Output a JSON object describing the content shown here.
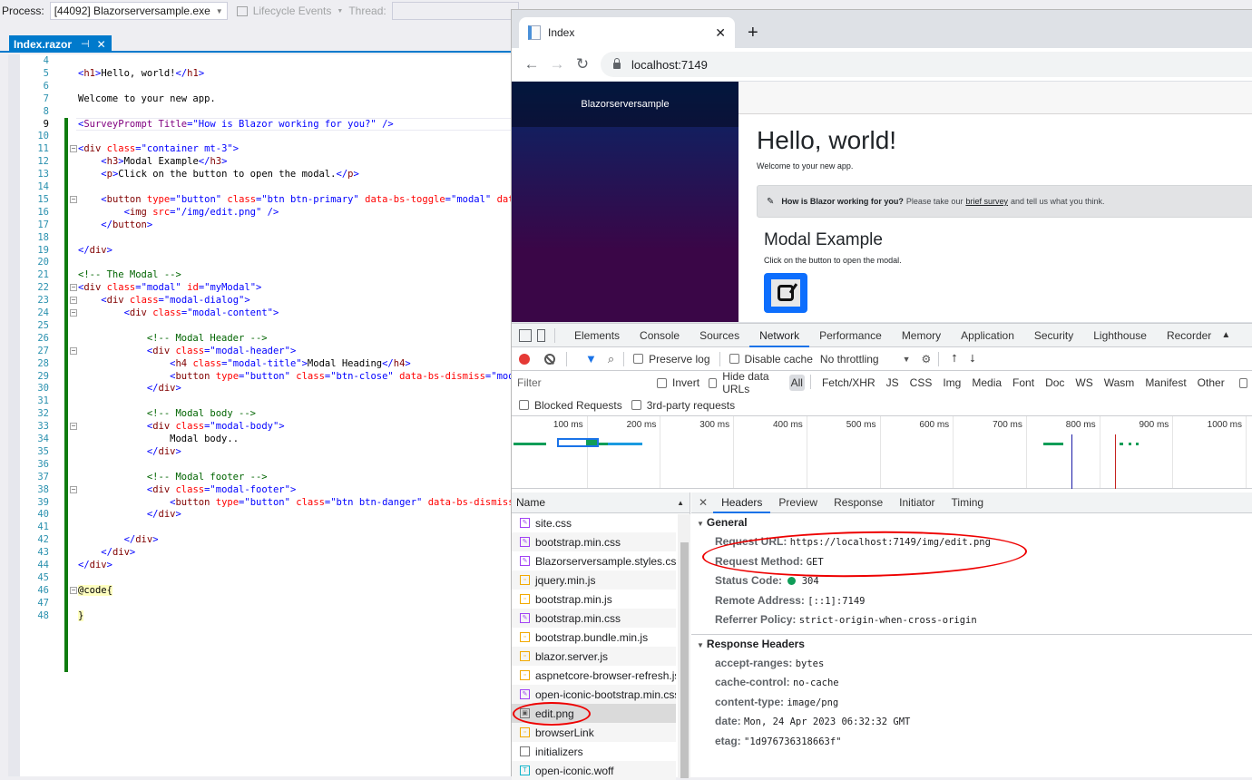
{
  "vs": {
    "process_label": "Process:",
    "process_value": "[44092] Blazorserversample.exe",
    "lifecycle_label": "Lifecycle Events",
    "thread_label": "Thread:",
    "doc_tab": "Index.razor"
  },
  "editor": {
    "lines": [
      {
        "n": "4",
        "html": ""
      },
      {
        "n": "5",
        "html": "<span class='t-tag'>&lt;</span><span class='t-name'>h1</span><span class='t-tag'>&gt;</span><span class='t-txt'>Hello, world!</span><span class='t-tag'>&lt;/</span><span class='t-name'>h1</span><span class='t-tag'>&gt;</span>"
      },
      {
        "n": "6",
        "html": ""
      },
      {
        "n": "7",
        "html": "<span class='t-txt'>Welcome to your new app.</span>"
      },
      {
        "n": "8",
        "html": ""
      },
      {
        "n": "9",
        "html": "<span class='t-tag'>&lt;</span><span class='t-comp'>SurveyPrompt</span> <span class='t-comp'>Title</span><span class='t-tag'>=</span><span class='t-val'>\"How is Blazor working for you?\"</span> <span class='t-tag'>/&gt;</span>"
      },
      {
        "n": "10",
        "html": ""
      },
      {
        "n": "11",
        "html": "<span class='t-tag'>&lt;</span><span class='t-name'>div</span> <span class='t-attr'>class</span><span class='t-tag'>=</span><span class='t-val'>\"container mt-3\"</span><span class='t-tag'>&gt;</span>"
      },
      {
        "n": "12",
        "html": "    <span class='t-tag'>&lt;</span><span class='t-name'>h3</span><span class='t-tag'>&gt;</span><span class='t-txt'>Modal Example</span><span class='t-tag'>&lt;/</span><span class='t-name'>h3</span><span class='t-tag'>&gt;</span>"
      },
      {
        "n": "13",
        "html": "    <span class='t-tag'>&lt;</span><span class='t-name'>p</span><span class='t-tag'>&gt;</span><span class='t-txt'>Click on the button to open the modal.</span><span class='t-tag'>&lt;/</span><span class='t-name'>p</span><span class='t-tag'>&gt;</span>"
      },
      {
        "n": "14",
        "html": ""
      },
      {
        "n": "15",
        "html": "    <span class='t-tag'>&lt;</span><span class='t-name'>button</span> <span class='t-attr'>type</span><span class='t-tag'>=</span><span class='t-val'>\"button\"</span> <span class='t-attr'>class</span><span class='t-tag'>=</span><span class='t-val'>\"btn btn-primary\"</span> <span class='t-attr'>data-bs-toggle</span><span class='t-tag'>=</span><span class='t-val'>\"modal\"</span> <span class='t-attr'>data-</span>"
      },
      {
        "n": "16",
        "html": "        <span class='t-tag'>&lt;</span><span class='t-name'>img</span> <span class='t-attr'>src</span><span class='t-tag'>=</span><span class='t-val'>\"/img/edit.png\"</span> <span class='t-tag'>/&gt;</span>"
      },
      {
        "n": "17",
        "html": "    <span class='t-tag'>&lt;/</span><span class='t-name'>button</span><span class='t-tag'>&gt;</span>"
      },
      {
        "n": "18",
        "html": ""
      },
      {
        "n": "19",
        "html": "<span class='t-tag'>&lt;/</span><span class='t-name'>div</span><span class='t-tag'>&gt;</span>"
      },
      {
        "n": "20",
        "html": ""
      },
      {
        "n": "21",
        "html": "<span class='t-cmt'>&lt;!-- The Modal --&gt;</span>"
      },
      {
        "n": "22",
        "html": "<span class='t-tag'>&lt;</span><span class='t-name'>div</span> <span class='t-attr'>class</span><span class='t-tag'>=</span><span class='t-val'>\"modal\"</span> <span class='t-attr'>id</span><span class='t-tag'>=</span><span class='t-val'>\"myModal\"</span><span class='t-tag'>&gt;</span>"
      },
      {
        "n": "23",
        "html": "    <span class='t-tag'>&lt;</span><span class='t-name'>div</span> <span class='t-attr'>class</span><span class='t-tag'>=</span><span class='t-val'>\"modal-dialog\"</span><span class='t-tag'>&gt;</span>"
      },
      {
        "n": "24",
        "html": "        <span class='t-tag'>&lt;</span><span class='t-name'>div</span> <span class='t-attr'>class</span><span class='t-tag'>=</span><span class='t-val'>\"modal-content\"</span><span class='t-tag'>&gt;</span>"
      },
      {
        "n": "25",
        "html": ""
      },
      {
        "n": "26",
        "html": "            <span class='t-cmt'>&lt;!-- Modal Header --&gt;</span>"
      },
      {
        "n": "27",
        "html": "            <span class='t-tag'>&lt;</span><span class='t-name'>div</span> <span class='t-attr'>class</span><span class='t-tag'>=</span><span class='t-val'>\"modal-header\"</span><span class='t-tag'>&gt;</span>"
      },
      {
        "n": "28",
        "html": "                <span class='t-tag'>&lt;</span><span class='t-name'>h4</span> <span class='t-attr'>class</span><span class='t-tag'>=</span><span class='t-val'>\"modal-title\"</span><span class='t-tag'>&gt;</span><span class='t-txt'>Modal Heading</span><span class='t-tag'>&lt;/</span><span class='t-name'>h4</span><span class='t-tag'>&gt;</span>"
      },
      {
        "n": "29",
        "html": "                <span class='t-tag'>&lt;</span><span class='t-name'>button</span> <span class='t-attr'>type</span><span class='t-tag'>=</span><span class='t-val'>\"button\"</span> <span class='t-attr'>class</span><span class='t-tag'>=</span><span class='t-val'>\"btn-close\"</span> <span class='t-attr'>data-bs-dismiss</span><span class='t-tag'>=</span><span class='t-val'>\"modal</span>"
      },
      {
        "n": "30",
        "html": "            <span class='t-tag'>&lt;/</span><span class='t-name'>div</span><span class='t-tag'>&gt;</span>"
      },
      {
        "n": "31",
        "html": ""
      },
      {
        "n": "32",
        "html": "            <span class='t-cmt'>&lt;!-- Modal body --&gt;</span>"
      },
      {
        "n": "33",
        "html": "            <span class='t-tag'>&lt;</span><span class='t-name'>div</span> <span class='t-attr'>class</span><span class='t-tag'>=</span><span class='t-val'>\"modal-body\"</span><span class='t-tag'>&gt;</span>"
      },
      {
        "n": "34",
        "html": "                <span class='t-txt'>Modal body..</span>"
      },
      {
        "n": "35",
        "html": "            <span class='t-tag'>&lt;/</span><span class='t-name'>div</span><span class='t-tag'>&gt;</span>"
      },
      {
        "n": "36",
        "html": ""
      },
      {
        "n": "37",
        "html": "            <span class='t-cmt'>&lt;!-- Modal footer --&gt;</span>"
      },
      {
        "n": "38",
        "html": "            <span class='t-tag'>&lt;</span><span class='t-name'>div</span> <span class='t-attr'>class</span><span class='t-tag'>=</span><span class='t-val'>\"modal-footer\"</span><span class='t-tag'>&gt;</span>"
      },
      {
        "n": "39",
        "html": "                <span class='t-tag'>&lt;</span><span class='t-name'>button</span> <span class='t-attr'>type</span><span class='t-tag'>=</span><span class='t-val'>\"button\"</span> <span class='t-attr'>class</span><span class='t-tag'>=</span><span class='t-val'>\"btn btn-danger\"</span> <span class='t-attr'>data-bs-dismiss</span><span class='t-tag'>=</span>"
      },
      {
        "n": "40",
        "html": "            <span class='t-tag'>&lt;/</span><span class='t-name'>div</span><span class='t-tag'>&gt;</span>"
      },
      {
        "n": "41",
        "html": ""
      },
      {
        "n": "42",
        "html": "        <span class='t-tag'>&lt;/</span><span class='t-name'>div</span><span class='t-tag'>&gt;</span>"
      },
      {
        "n": "43",
        "html": "    <span class='t-tag'>&lt;/</span><span class='t-name'>div</span><span class='t-tag'>&gt;</span>"
      },
      {
        "n": "44",
        "html": "<span class='t-tag'>&lt;/</span><span class='t-name'>div</span><span class='t-tag'>&gt;</span>"
      },
      {
        "n": "45",
        "html": ""
      },
      {
        "n": "46",
        "html": "<span class='t-razor'>@code{</span>"
      },
      {
        "n": "47",
        "html": ""
      },
      {
        "n": "48",
        "html": "<span class='t-razor'>}</span>"
      }
    ]
  },
  "browser": {
    "tab_title": "Index",
    "url": "localhost:7149",
    "page": {
      "brand": "Blazorserversample",
      "h1": "Hello, world!",
      "welcome": "Welcome to your new app.",
      "survey_bold": "How is Blazor working for you?",
      "survey_pre": "Please take our",
      "survey_link": "brief survey",
      "survey_post": "and tell us what you think.",
      "h3": "Modal Example",
      "p": "Click on the button to open the modal."
    }
  },
  "devtools": {
    "tabs": [
      "Elements",
      "Console",
      "Sources",
      "Network",
      "Performance",
      "Memory",
      "Application",
      "Security",
      "Lighthouse",
      "Recorder"
    ],
    "active_tab": "Network",
    "toolbar": {
      "preserve_log": "Preserve log",
      "disable_cache": "Disable cache",
      "throttling": "No throttling"
    },
    "filter": {
      "placeholder": "Filter",
      "invert": "Invert",
      "hide_data_urls": "Hide data URLs",
      "types": [
        "All",
        "Fetch/XHR",
        "JS",
        "CSS",
        "Img",
        "Media",
        "Font",
        "Doc",
        "WS",
        "Wasm",
        "Manifest",
        "Other"
      ],
      "active_type": "All",
      "blocked_requests": "Blocked Requests",
      "third_party": "3rd-party requests"
    },
    "overview": {
      "ticks": [
        "100 ms",
        "200 ms",
        "300 ms",
        "400 ms",
        "500 ms",
        "600 ms",
        "700 ms",
        "800 ms",
        "900 ms",
        "1000 ms"
      ]
    },
    "requests": {
      "column": "Name",
      "items": [
        {
          "name": "site.css",
          "type": "css"
        },
        {
          "name": "bootstrap.min.css",
          "type": "css"
        },
        {
          "name": "Blazorserversample.styles.css",
          "type": "css"
        },
        {
          "name": "jquery.min.js",
          "type": "js"
        },
        {
          "name": "bootstrap.min.js",
          "type": "js"
        },
        {
          "name": "bootstrap.min.css",
          "type": "css"
        },
        {
          "name": "bootstrap.bundle.min.js",
          "type": "js"
        },
        {
          "name": "blazor.server.js",
          "type": "js"
        },
        {
          "name": "aspnetcore-browser-refresh.js",
          "type": "js"
        },
        {
          "name": "open-iconic-bootstrap.min.css",
          "type": "css"
        },
        {
          "name": "edit.png",
          "type": "img",
          "selected": true
        },
        {
          "name": "browserLink",
          "type": "js"
        },
        {
          "name": "initializers",
          "type": "doc"
        },
        {
          "name": "open-iconic.woff",
          "type": "font"
        }
      ]
    },
    "detail": {
      "tabs": [
        "Headers",
        "Preview",
        "Response",
        "Initiator",
        "Timing"
      ],
      "active_tab": "Headers",
      "general_title": "General",
      "general": [
        {
          "key": "Request URL:",
          "value": "https://localhost:7149/img/edit.png"
        },
        {
          "key": "Request Method:",
          "value": "GET"
        },
        {
          "key": "Status Code:",
          "value": "304",
          "status_color": "#0f9d58"
        },
        {
          "key": "Remote Address:",
          "value": "[::1]:7149"
        },
        {
          "key": "Referrer Policy:",
          "value": "strict-origin-when-cross-origin"
        }
      ],
      "response_title": "Response Headers",
      "response": [
        {
          "key": "accept-ranges:",
          "value": "bytes"
        },
        {
          "key": "cache-control:",
          "value": "no-cache"
        },
        {
          "key": "content-type:",
          "value": "image/png"
        },
        {
          "key": "date:",
          "value": "Mon, 24 Apr 2023 06:32:32 GMT"
        },
        {
          "key": "etag:",
          "value": "\"1d976736318663f\""
        }
      ]
    }
  }
}
